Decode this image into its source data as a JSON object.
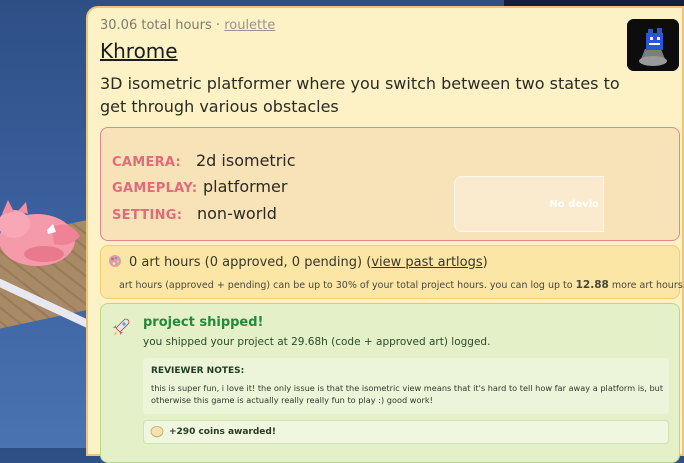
{
  "project": {
    "hours": "30.06 total hours",
    "separator": "·",
    "tag_link": "roulette",
    "title": "Khrome",
    "description": "3D isometric platformer where you switch between two states to get through various obstacles"
  },
  "tags": [
    {
      "key": "CAMERA:",
      "value": "2d isometric"
    },
    {
      "key": "GAMEPLAY:",
      "value": "platformer"
    },
    {
      "key": "SETTING:",
      "value": "non-world"
    }
  ],
  "overlay_text": "No devlo",
  "art": {
    "summary": "0 art hours (0 approved, 0 pending)",
    "link": "view past artlogs",
    "note_prefix": "art hours (approved + pending) can be up to 30% of your total project hours. you can log up to",
    "note_value": "12.88",
    "note_suffix": "more art hours."
  },
  "shipped": {
    "title": "project shipped!",
    "subtitle": "you shipped your project at 29.68h (code + approved art) logged.",
    "notes_heading": "REVIEWER NOTES:",
    "notes_text": "this is super fun, i love it! the only issue is that the isometric view means that it's hard to tell how far away a platform is, but otherwise this game is actually really really fun to play :) good work!",
    "coins": "+290 coins awarded!"
  },
  "icons": [
    "palette-icon",
    "rocket-icon",
    "coin-icon"
  ],
  "colors": {
    "accent_pink": "#e26b7a",
    "success_green": "#238a3a",
    "card_bg": "#fcf2c6"
  }
}
